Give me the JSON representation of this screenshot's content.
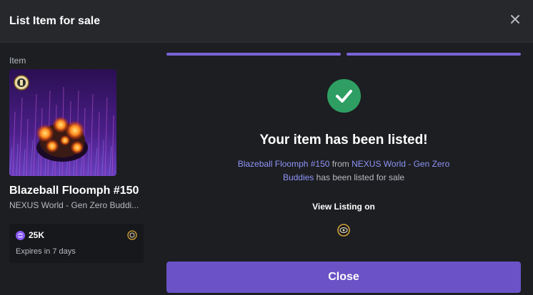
{
  "modal": {
    "title": "List Item for sale",
    "close_icon": "close-icon"
  },
  "item": {
    "section_label": "Item",
    "name": "Blazeball Floomph #150",
    "collection": "NEXUS World - Gen Zero Buddies",
    "collection_truncated": "NEXUS World - Gen Zero Buddi...",
    "image_icon": "nft-artwork",
    "badge_icon": "collection-badge-icon"
  },
  "listing": {
    "price": "25K",
    "currency_icon": "token-coin-icon",
    "chain_icon": "marketplace-logo-icon",
    "expires": "Expires in 7 days"
  },
  "progress": {
    "steps_completed": 2,
    "steps_total": 2,
    "color": "#7a63d8"
  },
  "success": {
    "icon": "check-icon",
    "icon_color": "#2f9e63",
    "title": "Your item has been listed!",
    "desc_item_link": "Blazeball Floomph #150",
    "desc_from": " from ",
    "desc_collection_link": "NEXUS World - Gen Zero Buddies",
    "desc_suffix": " has been listed for sale",
    "view_label": "View Listing on",
    "market_icon": "marketplace-logo-icon"
  },
  "footer": {
    "close_label": "Close",
    "button_color": "#6b52c6"
  }
}
